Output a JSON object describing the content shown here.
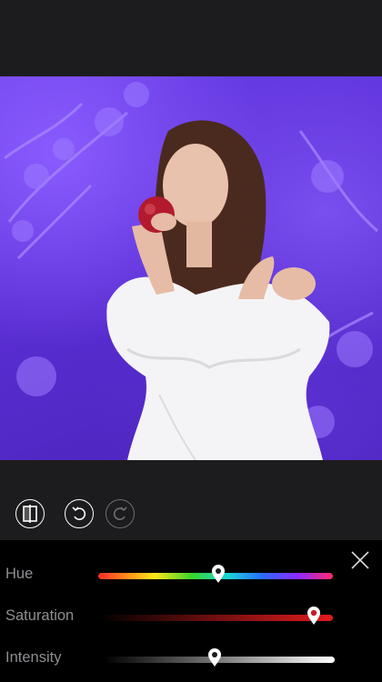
{
  "toolbar": {
    "compare_icon": "compare-split-icon",
    "undo_icon": "undo-icon",
    "redo_icon": "redo-icon",
    "redo_enabled": false
  },
  "panel": {
    "close_icon": "close-icon",
    "sliders": [
      {
        "label": "Hue",
        "value": 0.51,
        "pin_color": "#ffffff"
      },
      {
        "label": "Saturation",
        "value": 0.92,
        "pin_color": "#c51c2a"
      },
      {
        "label": "Intensity",
        "value": 0.48,
        "pin_color": "#ffffff"
      }
    ]
  },
  "colors": {
    "background": "#1c1c1e",
    "panel": "#000000",
    "label": "#8e8e93",
    "photo_tint": "#6a3ee8"
  }
}
